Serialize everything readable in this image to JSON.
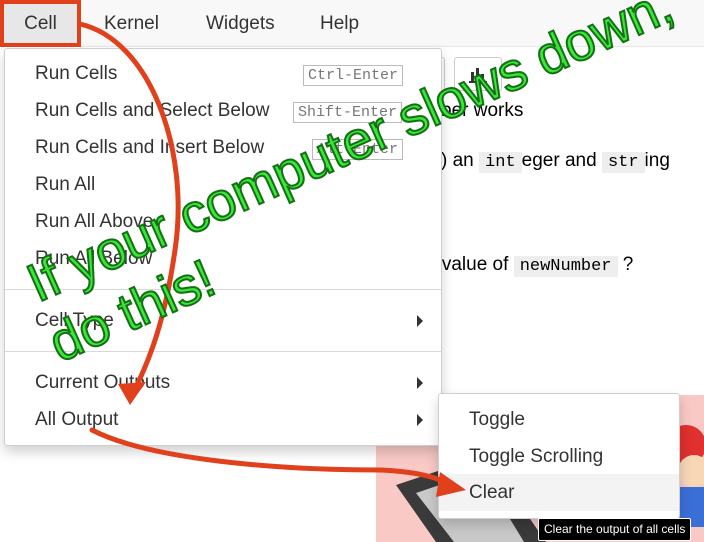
{
  "menubar": {
    "items": [
      "Cell",
      "Kernel",
      "Widgets",
      "Help"
    ]
  },
  "notebook": {
    "line1_tail": "ber works",
    "line2_a": ") an",
    "line2_code1": "int",
    "line2_b": "eger and",
    "line2_code2": "str",
    "line2_c": "ing",
    "line3_a": "e value of",
    "line3_code": "newNumber",
    "line3_b": "?"
  },
  "cell_menu": {
    "run_cells": "Run Cells",
    "run_cells_kbd": "Ctrl-Enter",
    "run_select_below": "Run Cells and Select Below",
    "run_select_below_kbd": "Shift-Enter",
    "run_insert_below": "Run Cells and Insert Below",
    "run_insert_below_kbd": "Alt-Enter",
    "run_all": "Run All",
    "run_all_above": "Run All Above",
    "run_all_below": "Run All Below",
    "cell_type": "Cell Type",
    "current_outputs": "Current Outputs",
    "all_output": "All Output"
  },
  "submenu": {
    "toggle": "Toggle",
    "toggle_scrolling": "Toggle Scrolling",
    "clear": "Clear"
  },
  "tooltip": "Clear the output of all cells",
  "annotation": {
    "line1": "If your computer slows down,",
    "line2": "do this!"
  },
  "colors": {
    "annotation_green": "#39e639",
    "arrow_orange": "#e0411c",
    "menu_highlight": "#f3f3f3"
  }
}
